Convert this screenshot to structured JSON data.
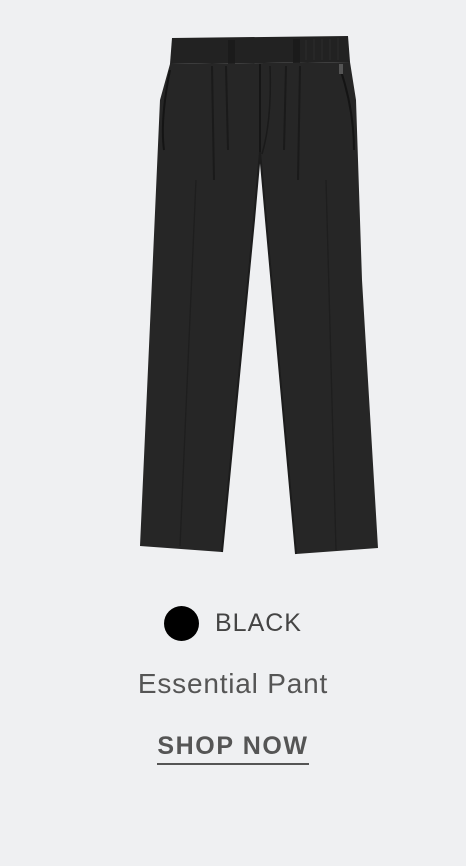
{
  "product": {
    "image_icon": "trousers-image",
    "color": {
      "name": "BLACK",
      "swatch_hex": "#000000"
    },
    "name": "Essential Pant",
    "cta_label": "SHOP NOW"
  },
  "colors": {
    "background": "#eff0f2",
    "garment": "#262626",
    "text": "#555555"
  }
}
